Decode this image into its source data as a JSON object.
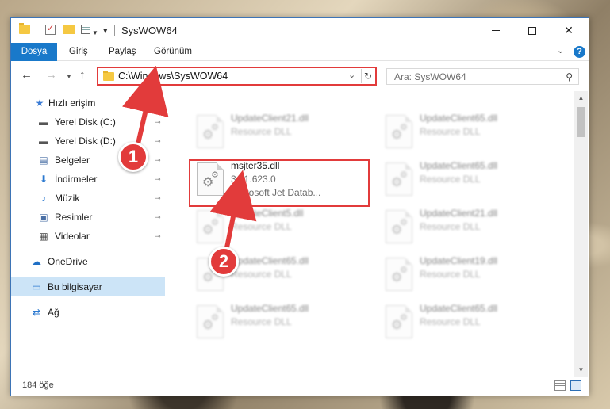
{
  "window": {
    "title": "SysWOW64",
    "controls": {
      "minimize": "minimize-icon",
      "maximize": "maximize-icon",
      "close": "✕"
    }
  },
  "ribbon": {
    "tabs": [
      "Dosya",
      "Giriş",
      "Paylaş",
      "Görünüm"
    ],
    "expand": "⌄",
    "help": "?"
  },
  "navigation": {
    "back": "←",
    "forward": "→",
    "recent": "⌄",
    "up": "↑",
    "address": "C:\\Windows\\SysWOW64",
    "address_dropdown": "⌄",
    "refresh": "↻",
    "search_placeholder": "Ara: SysWOW64",
    "search_icon": "⚲"
  },
  "sidebar": {
    "items": [
      {
        "label": "Hızlı erişim",
        "icon": "★",
        "icon_color": "#3a7bd5",
        "pinned": false
      },
      {
        "label": "Yerel Disk (C:)",
        "icon": "▬",
        "icon_color": "#555555",
        "pinned": true
      },
      {
        "label": "Yerel Disk (D:)",
        "icon": "▬",
        "icon_color": "#555555",
        "pinned": true
      },
      {
        "label": "Belgeler",
        "icon": "▤",
        "icon_color": "#4a6fa5",
        "pinned": true
      },
      {
        "label": "İndirmeler",
        "icon": "⬇",
        "icon_color": "#2b79d0",
        "pinned": true
      },
      {
        "label": "Müzik",
        "icon": "♪",
        "icon_color": "#2b79d0",
        "pinned": true
      },
      {
        "label": "Resimler",
        "icon": "▣",
        "icon_color": "#4a6fa5",
        "pinned": true
      },
      {
        "label": "Videolar",
        "icon": "▦",
        "icon_color": "#444444",
        "pinned": true
      },
      {
        "label": "OneDrive",
        "icon": "☁",
        "icon_color": "#1f6fc5",
        "pinned": false
      },
      {
        "label": "Bu bilgisayar",
        "icon": "▭",
        "icon_color": "#2b79d0",
        "pinned": false,
        "selected": true
      },
      {
        "label": "Ağ",
        "icon": "⇄",
        "icon_color": "#2b79d0",
        "pinned": false
      }
    ],
    "pin_icon": "📌"
  },
  "files": [
    {
      "name": "UpdateClient21.dll",
      "line2": "Resource DLL",
      "line3": "",
      "blurred": true
    },
    {
      "name": "UpdateClient65.dll",
      "line2": "Resource DLL",
      "line3": "",
      "blurred": true
    },
    {
      "name": "msjter35.dll",
      "line2": "3.51.623.0",
      "line3": "Microsoft Jet Datab...",
      "blurred": false
    },
    {
      "name": "UpdateClient65.dll",
      "line2": "Resource DLL",
      "line3": "",
      "blurred": true
    },
    {
      "name": "UpdateClient5.dll",
      "line2": "Resource DLL",
      "line3": "",
      "blurred": true
    },
    {
      "name": "UpdateClient21.dll",
      "line2": "Resource DLL",
      "line3": "",
      "blurred": true
    },
    {
      "name": "UpdateClient65.dll",
      "line2": "Resource DLL",
      "line3": "",
      "blurred": true
    },
    {
      "name": "UpdateClient19.dll",
      "line2": "Resource DLL",
      "line3": "",
      "blurred": true
    },
    {
      "name": "UpdateClient65.dll",
      "line2": "Resource DLL",
      "line3": "",
      "blurred": true
    },
    {
      "name": "UpdateClient65.dll",
      "line2": "Resource DLL",
      "line3": "",
      "blurred": true
    }
  ],
  "status": {
    "count": "184 öğe"
  },
  "callouts": {
    "one": "1",
    "two": "2",
    "color": "#e23b3b"
  }
}
